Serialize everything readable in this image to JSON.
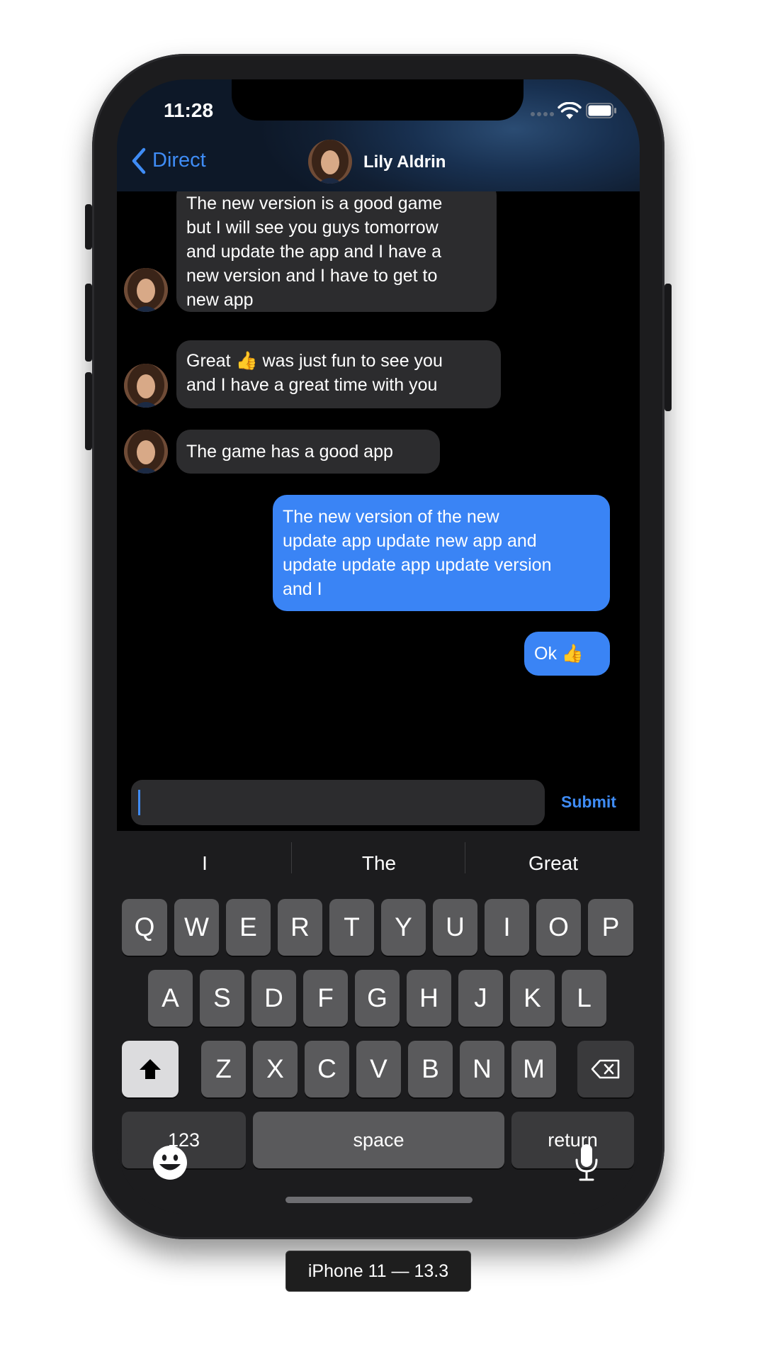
{
  "status_bar": {
    "time": "11:28",
    "icons": [
      "cellular-signal-icon",
      "wifi-icon",
      "battery-icon"
    ]
  },
  "nav": {
    "back_label": "Direct",
    "contact_name": "Lily Aldrin"
  },
  "messages": [
    {
      "direction": "incoming",
      "lines": [
        "The new version is a good game",
        "but I will see you guys tomorrow",
        "and update the app and I have a",
        "new version and I have to get to",
        "new app"
      ]
    },
    {
      "direction": "incoming",
      "lines": [
        "Great 👍 was just fun to see you",
        "and I have a great time with you"
      ]
    },
    {
      "direction": "incoming",
      "lines": [
        "The game has a good app"
      ]
    },
    {
      "direction": "outgoing",
      "lines": [
        "The new version of the new",
        "update app update new app and",
        "update update app update version",
        "and I"
      ]
    },
    {
      "direction": "outgoing",
      "lines": [
        "Ok 👍"
      ]
    }
  ],
  "composer": {
    "value": "",
    "submit_label": "Submit"
  },
  "keyboard": {
    "suggestions": [
      "I",
      "The",
      "Great"
    ],
    "row1": [
      "Q",
      "W",
      "E",
      "R",
      "T",
      "Y",
      "U",
      "I",
      "O",
      "P"
    ],
    "row2": [
      "A",
      "S",
      "D",
      "F",
      "G",
      "H",
      "J",
      "K",
      "L"
    ],
    "row3": [
      "Z",
      "X",
      "C",
      "V",
      "B",
      "N",
      "M"
    ],
    "numbers_label": "123",
    "space_label": "space",
    "return_label": "return"
  },
  "device_label": "iPhone 11 — 13.3",
  "colors": {
    "accent": "#3f8cf5",
    "outgoing_bubble": "#3a84f5",
    "incoming_bubble": "#2c2c2e",
    "chat_background": "#000000",
    "keyboard_background": "#1c1c1e",
    "key": "#5a5a5c"
  }
}
